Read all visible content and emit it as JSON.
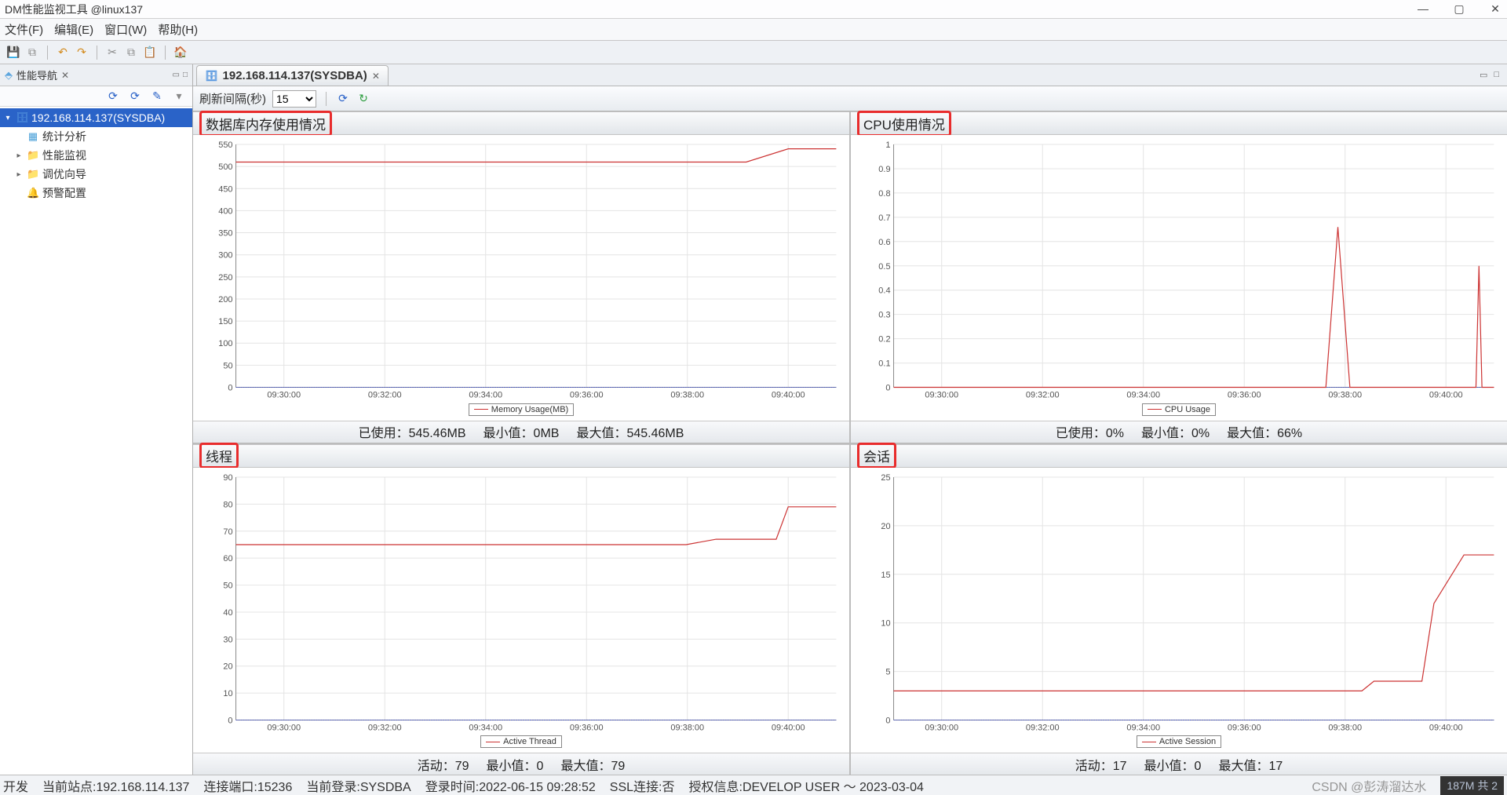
{
  "window": {
    "title": "DM性能监视工具 @linux137"
  },
  "menubar": {
    "file": "文件(F)",
    "edit": "编辑(E)",
    "window": "窗口(W)",
    "help": "帮助(H)"
  },
  "sidebar": {
    "panel_title": "性能导航",
    "host": "192.168.114.137(SYSDBA)",
    "items": [
      {
        "label": "统计分析",
        "icon": "stat-ico"
      },
      {
        "label": "性能监视",
        "icon": "folder-ico",
        "expand": true
      },
      {
        "label": "调优向导",
        "icon": "folder-ico",
        "expand": true
      },
      {
        "label": "预警配置",
        "icon": "warn-ico"
      }
    ]
  },
  "content_tab": {
    "label": "192.168.114.137(SYSDBA)"
  },
  "refresh": {
    "label": "刷新间隔(秒)",
    "value": "15"
  },
  "panels": {
    "memory": {
      "title": "数据库内存使用情况",
      "legend": "Memory Usage(MB)",
      "footer_used_label": "已使用：",
      "footer_used": "545.46MB",
      "footer_min_label": "最小值：",
      "footer_min": "0MB",
      "footer_max_label": "最大值：",
      "footer_max": "545.46MB"
    },
    "cpu": {
      "title": "CPU使用情况",
      "legend": "CPU Usage",
      "footer_used_label": "已使用：",
      "footer_used": "0%",
      "footer_min_label": "最小值：",
      "footer_min": "0%",
      "footer_max_label": "最大值：",
      "footer_max": "66%"
    },
    "thread": {
      "title": "线程",
      "legend": "Active Thread",
      "footer_used_label": "活动：",
      "footer_used": "79",
      "footer_min_label": "最小值：",
      "footer_min": "0",
      "footer_max_label": "最大值：",
      "footer_max": "79"
    },
    "session": {
      "title": "会话",
      "legend": "Active Session",
      "footer_used_label": "活动：",
      "footer_used": "17",
      "footer_min_label": "最小值：",
      "footer_min": "0",
      "footer_max_label": "最大值：",
      "footer_max": "17"
    }
  },
  "status": {
    "dev": "开发",
    "site_label": "当前站点:",
    "site": "192.168.114.137",
    "port_label": "连接端口:",
    "port": "15236",
    "user_label": "当前登录:",
    "user": "SYSDBA",
    "login_time_label": "登录时间:",
    "login_time": "2022-06-15 09:28:52",
    "ssl_label": "SSL连接:",
    "ssl": "否",
    "auth_label": "授权信息:",
    "auth": "DEVELOP USER ～ 2023-03-04",
    "watermark": "CSDN @彭涛溜达水",
    "right": "187M 共 2"
  },
  "chart_data": [
    {
      "id": "memory",
      "type": "line",
      "title": "数据库内存使用情况",
      "xlabel": "",
      "ylabel": "Memory Usage(MB)",
      "ylim": [
        0,
        550
      ],
      "yticks": [
        0,
        50,
        100,
        150,
        200,
        250,
        300,
        350,
        400,
        450,
        500,
        550
      ],
      "xticks": [
        "09:30:00",
        "09:32:00",
        "09:34:00",
        "09:36:00",
        "09:38:00",
        "09:40:00"
      ],
      "series": [
        {
          "name": "Memory Usage(MB)",
          "x": [
            0,
            0.1,
            0.85,
            0.92,
            1.0
          ],
          "y": [
            510,
            510,
            510,
            540,
            540
          ],
          "color": "#cc3333"
        }
      ],
      "baseline": 0
    },
    {
      "id": "cpu",
      "type": "line",
      "title": "CPU使用情况",
      "xlabel": "",
      "ylabel": "CPU Usage",
      "ylim": [
        0,
        1
      ],
      "yticks": [
        0,
        0.1,
        0.2,
        0.3,
        0.4,
        0.5,
        0.6,
        0.7,
        0.8,
        0.9,
        1
      ],
      "xticks": [
        "09:30:00",
        "09:32:00",
        "09:34:00",
        "09:36:00",
        "09:38:00",
        "09:40:00"
      ],
      "series": [
        {
          "name": "CPU Usage",
          "x": [
            0,
            0.72,
            0.74,
            0.76,
            0.78,
            0.97,
            0.975,
            0.98,
            1.0
          ],
          "y": [
            0,
            0,
            0.66,
            0,
            0,
            0,
            0.5,
            0,
            0
          ],
          "color": "#cc3333"
        }
      ],
      "baseline": 0
    },
    {
      "id": "thread",
      "type": "line",
      "title": "线程",
      "xlabel": "",
      "ylabel": "Active Thread",
      "ylim": [
        0,
        90
      ],
      "yticks": [
        0,
        10,
        20,
        30,
        40,
        50,
        60,
        70,
        80,
        90
      ],
      "xticks": [
        "09:30:00",
        "09:32:00",
        "09:34:00",
        "09:36:00",
        "09:38:00",
        "09:40:00"
      ],
      "series": [
        {
          "name": "Active Thread",
          "x": [
            0,
            0.05,
            0.75,
            0.8,
            0.9,
            0.92,
            1.0
          ],
          "y": [
            65,
            65,
            65,
            67,
            67,
            79,
            79
          ],
          "color": "#cc3333"
        }
      ],
      "baseline": 0
    },
    {
      "id": "session",
      "type": "line",
      "title": "会话",
      "xlabel": "",
      "ylabel": "Active Session",
      "ylim": [
        0,
        25
      ],
      "yticks": [
        0,
        5,
        10,
        15,
        20,
        25
      ],
      "xticks": [
        "09:30:00",
        "09:32:00",
        "09:34:00",
        "09:36:00",
        "09:38:00",
        "09:40:00"
      ],
      "series": [
        {
          "name": "Active Session",
          "x": [
            0,
            0.05,
            0.78,
            0.8,
            0.88,
            0.9,
            0.92,
            0.95,
            1.0
          ],
          "y": [
            3,
            3,
            3,
            4,
            4,
            12,
            14,
            17,
            17
          ],
          "color": "#cc3333"
        }
      ],
      "baseline": 0
    }
  ]
}
